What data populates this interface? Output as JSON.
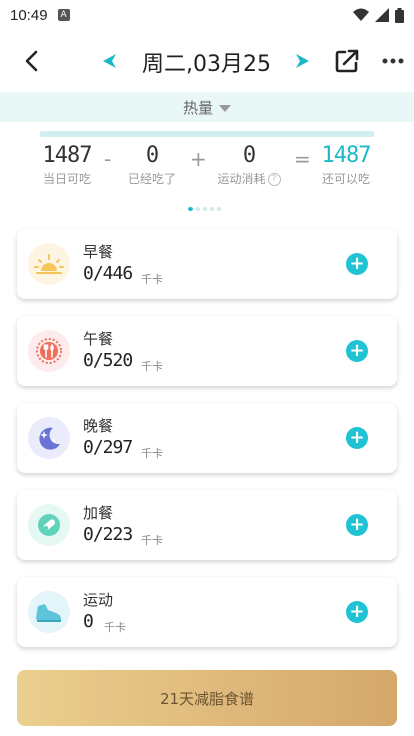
{
  "status_bar": {
    "time": "10:49",
    "notification_badge": "A"
  },
  "header": {
    "date_title": "周二,03月25"
  },
  "calorie_band": {
    "label": "热量"
  },
  "progress": {
    "consumed_fraction": 0.0
  },
  "summary": {
    "budget": {
      "value": "1487",
      "label": "当日可吃"
    },
    "minus": "-",
    "eaten": {
      "value": "0",
      "label": "已经吃了"
    },
    "plus": "+",
    "exercise": {
      "value": "0",
      "label": "运动消耗"
    },
    "equals": "=",
    "remaining": {
      "value": "1487",
      "label": "还可以吃"
    }
  },
  "meals": [
    {
      "name": "早餐",
      "value": "0/446",
      "unit": "千卡",
      "icon": "sunrise-icon",
      "color": "#f5c45a"
    },
    {
      "name": "午餐",
      "value": "0/520",
      "unit": "千卡",
      "icon": "utensils-icon",
      "color": "#ef6f5c"
    },
    {
      "name": "晚餐",
      "value": "0/297",
      "unit": "千卡",
      "icon": "moon-icon",
      "color": "#6b73d6"
    },
    {
      "name": "加餐",
      "value": "0/223",
      "unit": "千卡",
      "icon": "snack-icon",
      "color": "#5fd3b9"
    },
    {
      "name": "运动",
      "value": "0",
      "unit": "千卡",
      "icon": "shoe-icon",
      "color": "#5ec4d9"
    }
  ],
  "plan_button": {
    "label": "21天减脂食谱"
  },
  "colors": {
    "accent": "#1cb8c8",
    "add_button": "#1fc3d3",
    "band_bg": "#e9f7f7",
    "plan_gradient_start": "#ebcf8f",
    "plan_gradient_end": "#d5a76b"
  }
}
